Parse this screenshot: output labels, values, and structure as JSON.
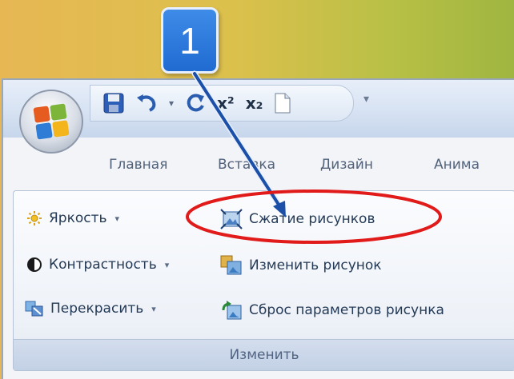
{
  "callout": {
    "number": "1"
  },
  "quick_access": {
    "save_icon": "save-icon",
    "undo_icon": "undo-icon",
    "redo_icon": "redo-icon",
    "superscript_label": "x²",
    "subscript_label": "x₂",
    "new_icon": "new-document-icon",
    "dropdown_glyph": "▾"
  },
  "tabs": [
    {
      "label": "Главная"
    },
    {
      "label": "Вставка"
    },
    {
      "label": "Дизайн"
    },
    {
      "label": "Анима"
    }
  ],
  "ribbon": {
    "brightness": {
      "label": "Яркость",
      "dropdown": "▾"
    },
    "contrast": {
      "label": "Контрастность",
      "dropdown": "▾"
    },
    "recolor": {
      "label": "Перекрасить",
      "dropdown": "▾"
    },
    "compress": {
      "label": "Сжатие рисунков"
    },
    "change_picture": {
      "label": "Изменить рисунок"
    },
    "reset_picture": {
      "label": "Сброс параметров рисунка"
    },
    "group_label": "Изменить"
  },
  "colors": {
    "callout_blue": "#2a78de",
    "highlight_ellipse": "#e11a1a",
    "arrow_blue": "#1b4fa8"
  }
}
